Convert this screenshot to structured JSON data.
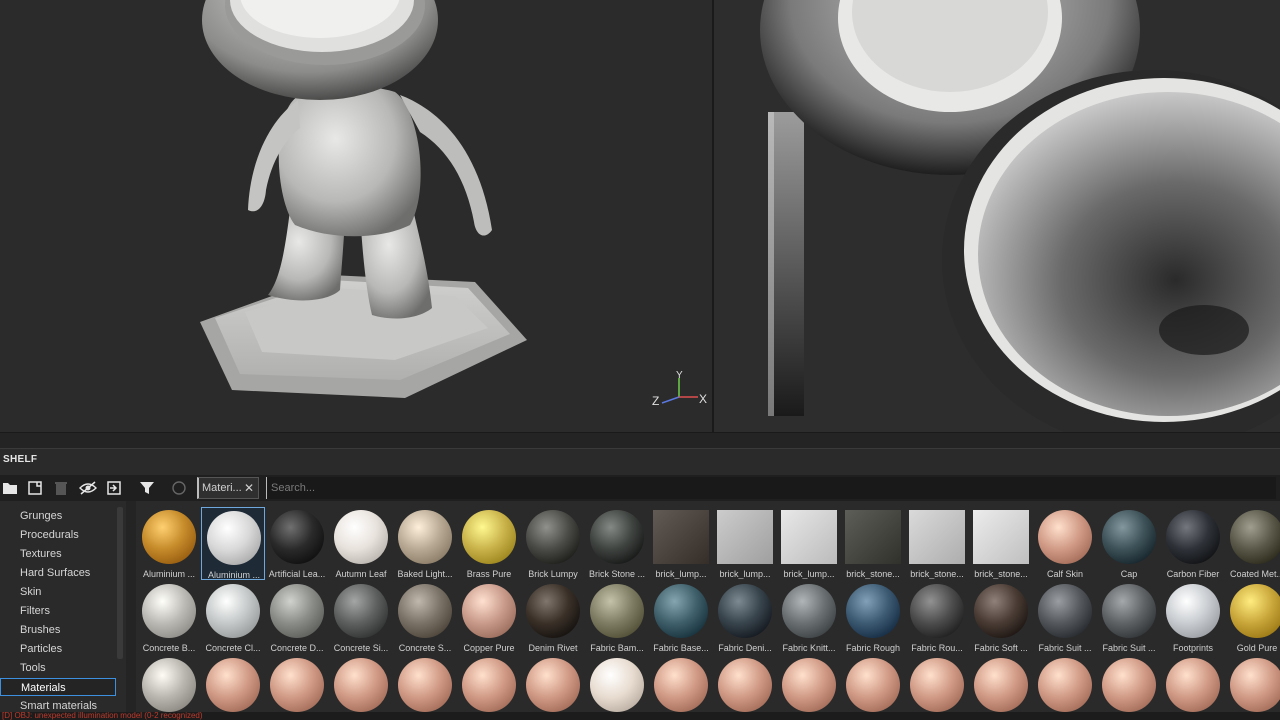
{
  "shelf": {
    "title": "SHELF",
    "filter_tag": "Materi...",
    "filter_tag_close": "✕",
    "search_placeholder": "Search..."
  },
  "axis": {
    "x": "X",
    "y": "Y",
    "z": "Z"
  },
  "categories": [
    {
      "label": "Grunges",
      "selected": false
    },
    {
      "label": "Procedurals",
      "selected": false
    },
    {
      "label": "Textures",
      "selected": false
    },
    {
      "label": "Hard Surfaces",
      "selected": false
    },
    {
      "label": "Skin",
      "selected": false
    },
    {
      "label": "Filters",
      "selected": false
    },
    {
      "label": "Brushes",
      "selected": false
    },
    {
      "label": "Particles",
      "selected": false
    },
    {
      "label": "Tools",
      "selected": false
    },
    {
      "label": "Materials",
      "selected": true
    },
    {
      "label": "Smart materials",
      "selected": false
    }
  ],
  "materials_row1": [
    {
      "label": "Aluminium ...",
      "shape": "ball",
      "color": "#c58a2a",
      "selected": false
    },
    {
      "label": "Aluminium ...",
      "shape": "ball",
      "color": "#d8d8d8",
      "selected": true
    },
    {
      "label": "Artificial Lea...",
      "shape": "ball",
      "color": "#2a2a2a",
      "selected": false
    },
    {
      "label": "Autumn Leaf",
      "shape": "ball",
      "color": "#e8e2dc",
      "selected": false
    },
    {
      "label": "Baked Light...",
      "shape": "ball",
      "color": "#b8a994",
      "selected": false
    },
    {
      "label": "Brass Pure",
      "shape": "ball",
      "color": "#c9b24a",
      "selected": false
    },
    {
      "label": "Brick Lumpy",
      "shape": "ball",
      "color": "#4a4a46",
      "selected": false
    },
    {
      "label": "Brick Stone ...",
      "shape": "ball",
      "color": "#3f4340",
      "selected": false
    },
    {
      "label": "brick_lump...",
      "shape": "square",
      "color": "#4e4640",
      "selected": false
    },
    {
      "label": "brick_lump...",
      "shape": "square",
      "color": "#b8b8b8",
      "selected": false
    },
    {
      "label": "brick_lump...",
      "shape": "square",
      "color": "#d4d4d4",
      "selected": false
    },
    {
      "label": "brick_stone...",
      "shape": "square",
      "color": "#4a4a44",
      "selected": false
    },
    {
      "label": "brick_stone...",
      "shape": "square",
      "color": "#c6c6c6",
      "selected": false
    },
    {
      "label": "brick_stone...",
      "shape": "square",
      "color": "#d8d8d8",
      "selected": false
    },
    {
      "label": "Calf Skin",
      "shape": "ball",
      "color": "#d09a86",
      "selected": false
    },
    {
      "label": "Cap",
      "shape": "ball",
      "color": "#3d5258",
      "selected": false
    },
    {
      "label": "Carbon Fiber",
      "shape": "ball",
      "color": "#2e3238",
      "selected": false
    },
    {
      "label": "Coated Met...",
      "shape": "ball",
      "color": "#5a5848",
      "selected": false
    }
  ],
  "materials_row2": [
    {
      "label": "Concrete B...",
      "shape": "ball",
      "color": "#bcbab4"
    },
    {
      "label": "Concrete Cl...",
      "shape": "ball",
      "color": "#c4c8c8"
    },
    {
      "label": "Concrete D...",
      "shape": "ball",
      "color": "#8a8c88"
    },
    {
      "label": "Concrete Si...",
      "shape": "ball",
      "color": "#5e6060"
    },
    {
      "label": "Concrete S...",
      "shape": "ball",
      "color": "#7a7266"
    },
    {
      "label": "Copper Pure",
      "shape": "ball",
      "color": "#c89a8a"
    },
    {
      "label": "Denim Rivet",
      "shape": "ball",
      "color": "#3a3028"
    },
    {
      "label": "Fabric Bam...",
      "shape": "ball",
      "color": "#7e7c62"
    },
    {
      "label": "Fabric Base...",
      "shape": "ball",
      "color": "#3f5f6a"
    },
    {
      "label": "Fabric Deni...",
      "shape": "ball",
      "color": "#38444c"
    },
    {
      "label": "Fabric Knitt...",
      "shape": "ball",
      "color": "#6a7072"
    },
    {
      "label": "Fabric Rough",
      "shape": "ball",
      "color": "#3c5a72"
    },
    {
      "label": "Fabric Rou...",
      "shape": "ball",
      "color": "#4c4c4c"
    },
    {
      "label": "Fabric Soft ...",
      "shape": "ball",
      "color": "#4a3c34"
    },
    {
      "label": "Fabric Suit ...",
      "shape": "ball",
      "color": "#54585c"
    },
    {
      "label": "Fabric Suit ...",
      "shape": "ball",
      "color": "#5e6264"
    },
    {
      "label": "Footprints",
      "shape": "ball",
      "color": "#c8ccd0"
    },
    {
      "label": "Gold Pure",
      "shape": "ball",
      "color": "#c9a63a"
    }
  ],
  "materials_row3": [
    {
      "color": "#b8b6ae"
    },
    {
      "color": "#d09a86"
    },
    {
      "color": "#d09a86"
    },
    {
      "color": "#d09a86"
    },
    {
      "color": "#d09a86"
    },
    {
      "color": "#d09a86"
    },
    {
      "color": "#d09a86"
    },
    {
      "color": "#e8dcd0"
    },
    {
      "color": "#d09a86"
    },
    {
      "color": "#d09a86"
    },
    {
      "color": "#d09a86"
    },
    {
      "color": "#d09a86"
    },
    {
      "color": "#d09a86"
    },
    {
      "color": "#d09a86"
    },
    {
      "color": "#d09a86"
    },
    {
      "color": "#d09a86"
    },
    {
      "color": "#d09a86"
    },
    {
      "color": "#d09a86"
    }
  ],
  "status": "[D] OBJ: unexpected illumination model (0-2 recognized)"
}
